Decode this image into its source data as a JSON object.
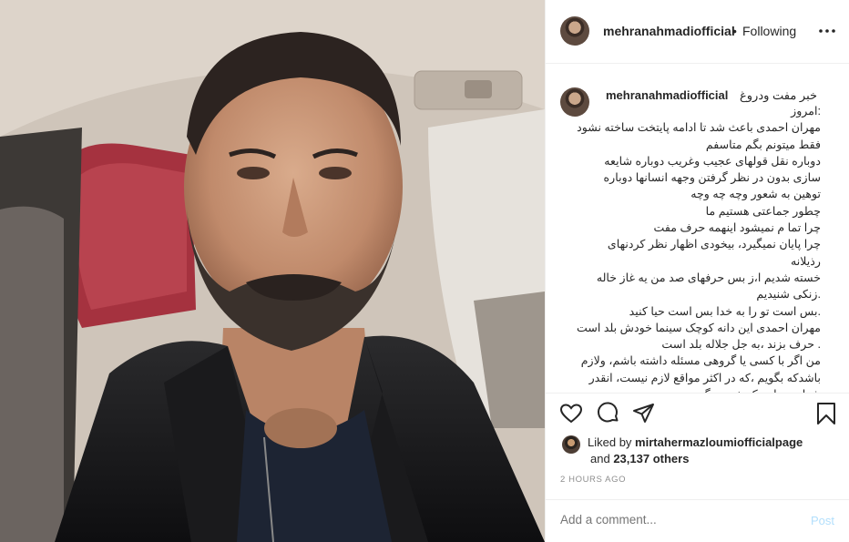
{
  "header": {
    "username": "mehranahmadiofficial",
    "separator": "•",
    "follow_status": "Following",
    "more_icon": "more-options-icon"
  },
  "caption": {
    "username": "mehranahmadiofficial",
    "first_line": "خبر مفت ودروغ",
    "lines": [
      ":امروز",
      "مهران احمدی باعث شد تا ادامه پایتخت ساخته نشود",
      "فقط میتونم بگم متاسفم",
      "دوباره نقل قولهای عجیب وغریب دوباره شایعه",
      "سازی بدون در نظر گرفتن وجهه انسانها دوباره",
      "توهین به شعور وچه چه وچه",
      "چطور جماعتی هستیم ما",
      "چرا تما م نمیشود اینهمه حرف مفت",
      "چرا پایان نمیگیرد، بیخودی اظهار نظر کردنهای",
      "رذیلانه",
      "خسته شدیم ا،ز بس حرفهای صد من یه غاز خاله",
      ".زنکی شنیدیم",
      ".بس است تو را به خدا بس است حیا کنید",
      "مهران احمدی این دانه کوچک سینما خودش بلد است",
      ". حرف بزند ،به جل جلاله بلد است",
      "من اگر با کسی یا گروهی مسئله داشته باشم، ولازم",
      "باشدکه بگویم ،که در اکثر مواقع لازم نیست، انقدر",
      "شهامت دارم که خودم بگویم"
    ]
  },
  "actions": {
    "like_icon": "heart-icon",
    "comment_icon": "comment-icon",
    "share_icon": "share-icon",
    "save_icon": "bookmark-icon"
  },
  "likes": {
    "prefix": "Liked by",
    "liker": "mirtahermazloumiofficialpage",
    "and": "and",
    "count": "23,137 others"
  },
  "timestamp": "2 HOURS AGO",
  "comment_box": {
    "placeholder": "Add a comment...",
    "post_label": "Post"
  },
  "colors": {
    "text": "#262626",
    "muted": "#8e8e8e",
    "post_disabled": "#b2dffc",
    "border": "#efefef"
  }
}
